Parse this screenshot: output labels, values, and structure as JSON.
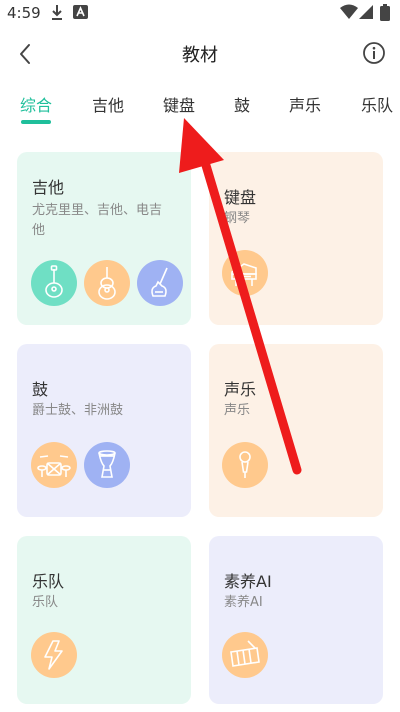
{
  "status_bar": {
    "time": "4:59"
  },
  "header": {
    "title": "教材"
  },
  "tabs": [
    "综合",
    "吉他",
    "键盘",
    "鼓",
    "声乐",
    "乐队"
  ],
  "cards": [
    {
      "title": "吉他",
      "subtitle": "尤克里里、吉他、电吉他",
      "icons": [
        "ukulele-icon",
        "acoustic-guitar-icon",
        "electric-guitar-icon"
      ]
    },
    {
      "title": "键盘",
      "subtitle": "钢琴",
      "icons": [
        "piano-icon"
      ]
    },
    {
      "title": "鼓",
      "subtitle": "爵士鼓、非洲鼓",
      "icons": [
        "drum-kit-icon",
        "djembe-icon"
      ]
    },
    {
      "title": "声乐",
      "subtitle": "声乐",
      "icons": [
        "microphone-icon"
      ]
    },
    {
      "title": "乐队",
      "subtitle": "乐队",
      "icons": [
        "lightning-icon"
      ]
    },
    {
      "title": "素养AI",
      "subtitle": "素养AI",
      "icons": [
        "xylophone-icon"
      ]
    }
  ],
  "colors": {
    "accent": "#1fbf9b",
    "card_mint": "#e6f8f1",
    "card_peach": "#fdf1e6",
    "card_lavender": "#ecedfb",
    "icon_teal": "#6fdfc4",
    "icon_orange": "#ffc98d",
    "icon_blue": "#9fb2f3",
    "annotation_arrow": "#ee1c1c"
  }
}
